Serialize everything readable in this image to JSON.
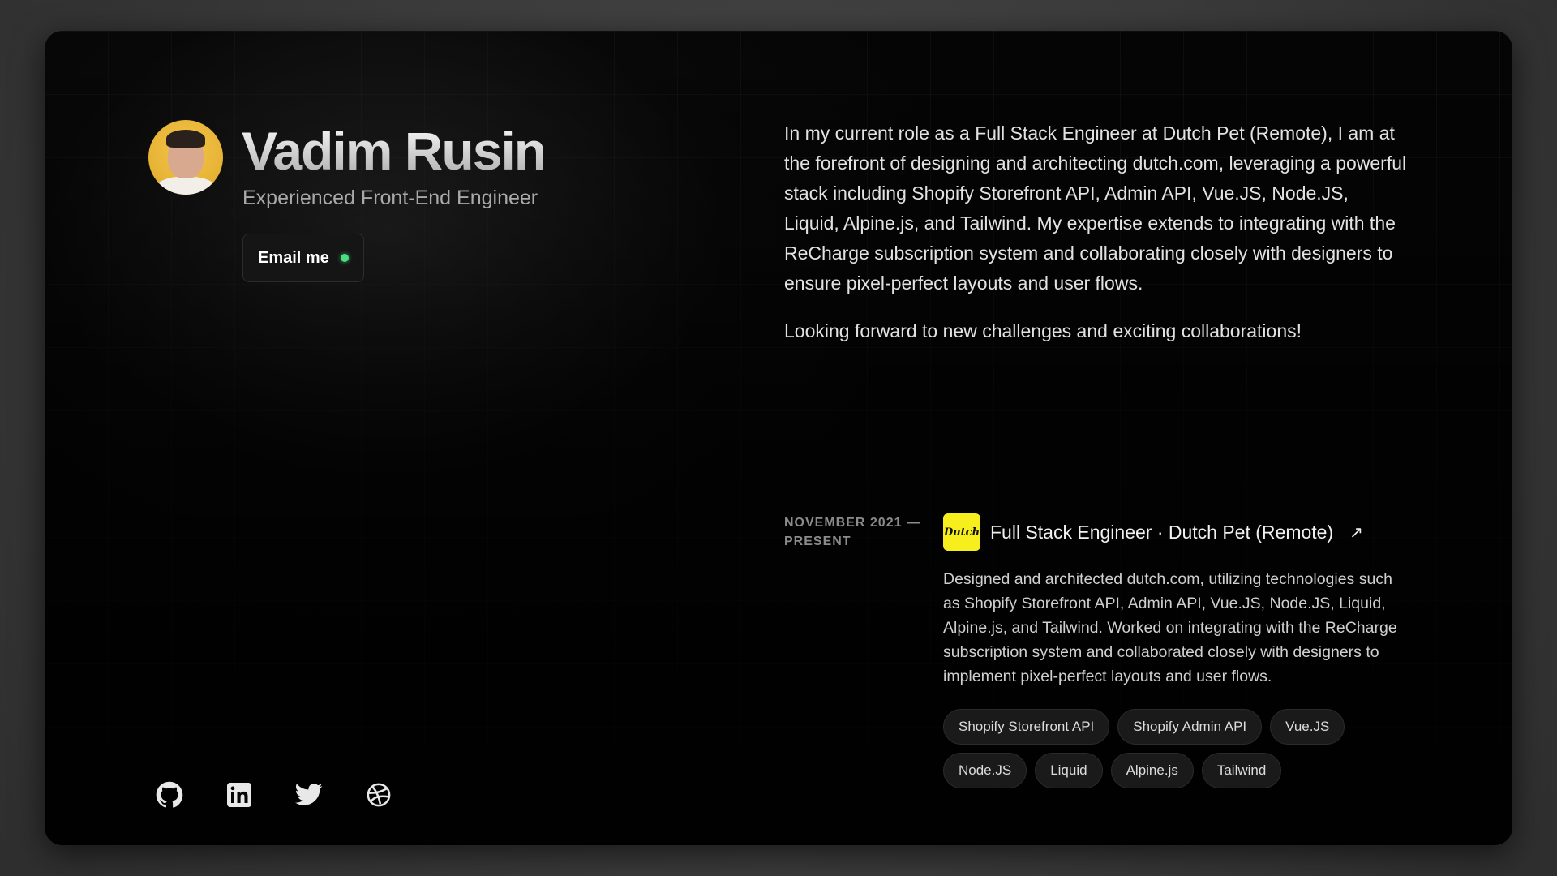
{
  "profile": {
    "name": "Vadim Rusin",
    "subtitle": "Experienced Front-End Engineer",
    "email_label": "Email me"
  },
  "about": {
    "paragraphs": [
      "In my current role as a Full Stack Engineer at Dutch Pet (Remote), I am at the forefront of designing and architecting dutch.com, leveraging a powerful stack including Shopify Storefront API, Admin API, Vue.JS, Node.JS, Liquid, Alpine.js, and Tailwind. My expertise extends to integrating with the ReCharge subscription system and collaborating closely with designers to ensure pixel-perfect layouts and user flows.",
      "Looking forward to new challenges and exciting collaborations!"
    ]
  },
  "experience": [
    {
      "date_line1": "NOVEMBER 2021 —",
      "date_line2": "PRESENT",
      "logo_text": "Dutch",
      "title": "Full Stack Engineer · Dutch Pet (Remote)",
      "arrow": "↗",
      "description": "Designed and architected dutch.com, utilizing technologies such as Shopify Storefront API, Admin API, Vue.JS, Node.JS, Liquid, Alpine.js, and Tailwind. Worked on integrating with the ReCharge subscription system and collaborated closely with designers to implement pixel-perfect layouts and user flows.",
      "tags": [
        "Shopify Storefront API",
        "Shopify Admin API",
        "Vue.JS",
        "Node.JS",
        "Liquid",
        "Alpine.js",
        "Tailwind"
      ]
    }
  ],
  "socials": [
    {
      "icon": "github-icon"
    },
    {
      "icon": "linkedin-icon"
    },
    {
      "icon": "twitter-icon"
    },
    {
      "icon": "dribbble-icon"
    }
  ],
  "colors": {
    "status_dot": "#4ade80",
    "dutch_logo_bg": "#f7ef1d",
    "avatar_bg": "#e8b535"
  }
}
